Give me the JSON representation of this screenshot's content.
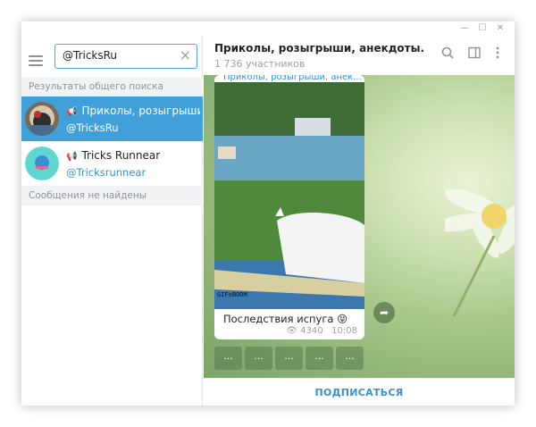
{
  "sidebar": {
    "search": {
      "value": "@TricksRu"
    },
    "global_results_label": "Результаты общего поиска",
    "results": [
      {
        "title": "Приколы, розыгрыши, ...",
        "handle": "@TricksRu"
      },
      {
        "title": "Tricks Runnear",
        "handle": "@Tricksrunnear"
      }
    ],
    "no_messages_label": "Сообщения не найдены"
  },
  "chat": {
    "title": "Приколы, розыгрыши, анекдоты.",
    "subtitle": "1 736 участников",
    "message": {
      "link_text": "Приколы, розыгрыши, анек...",
      "caption": "Последствия испуга 😝",
      "views": "4340",
      "time": "10:08",
      "watermark": "GIFsBOOM"
    },
    "bot_buttons": [
      "...",
      "...",
      "...",
      "...",
      "..."
    ],
    "subscribe_label": "ПОДПИСАТЬСЯ"
  },
  "colors": {
    "accent": "#419fd9",
    "link": "#3a8fd3",
    "chat_bg": "#a9c88d"
  }
}
